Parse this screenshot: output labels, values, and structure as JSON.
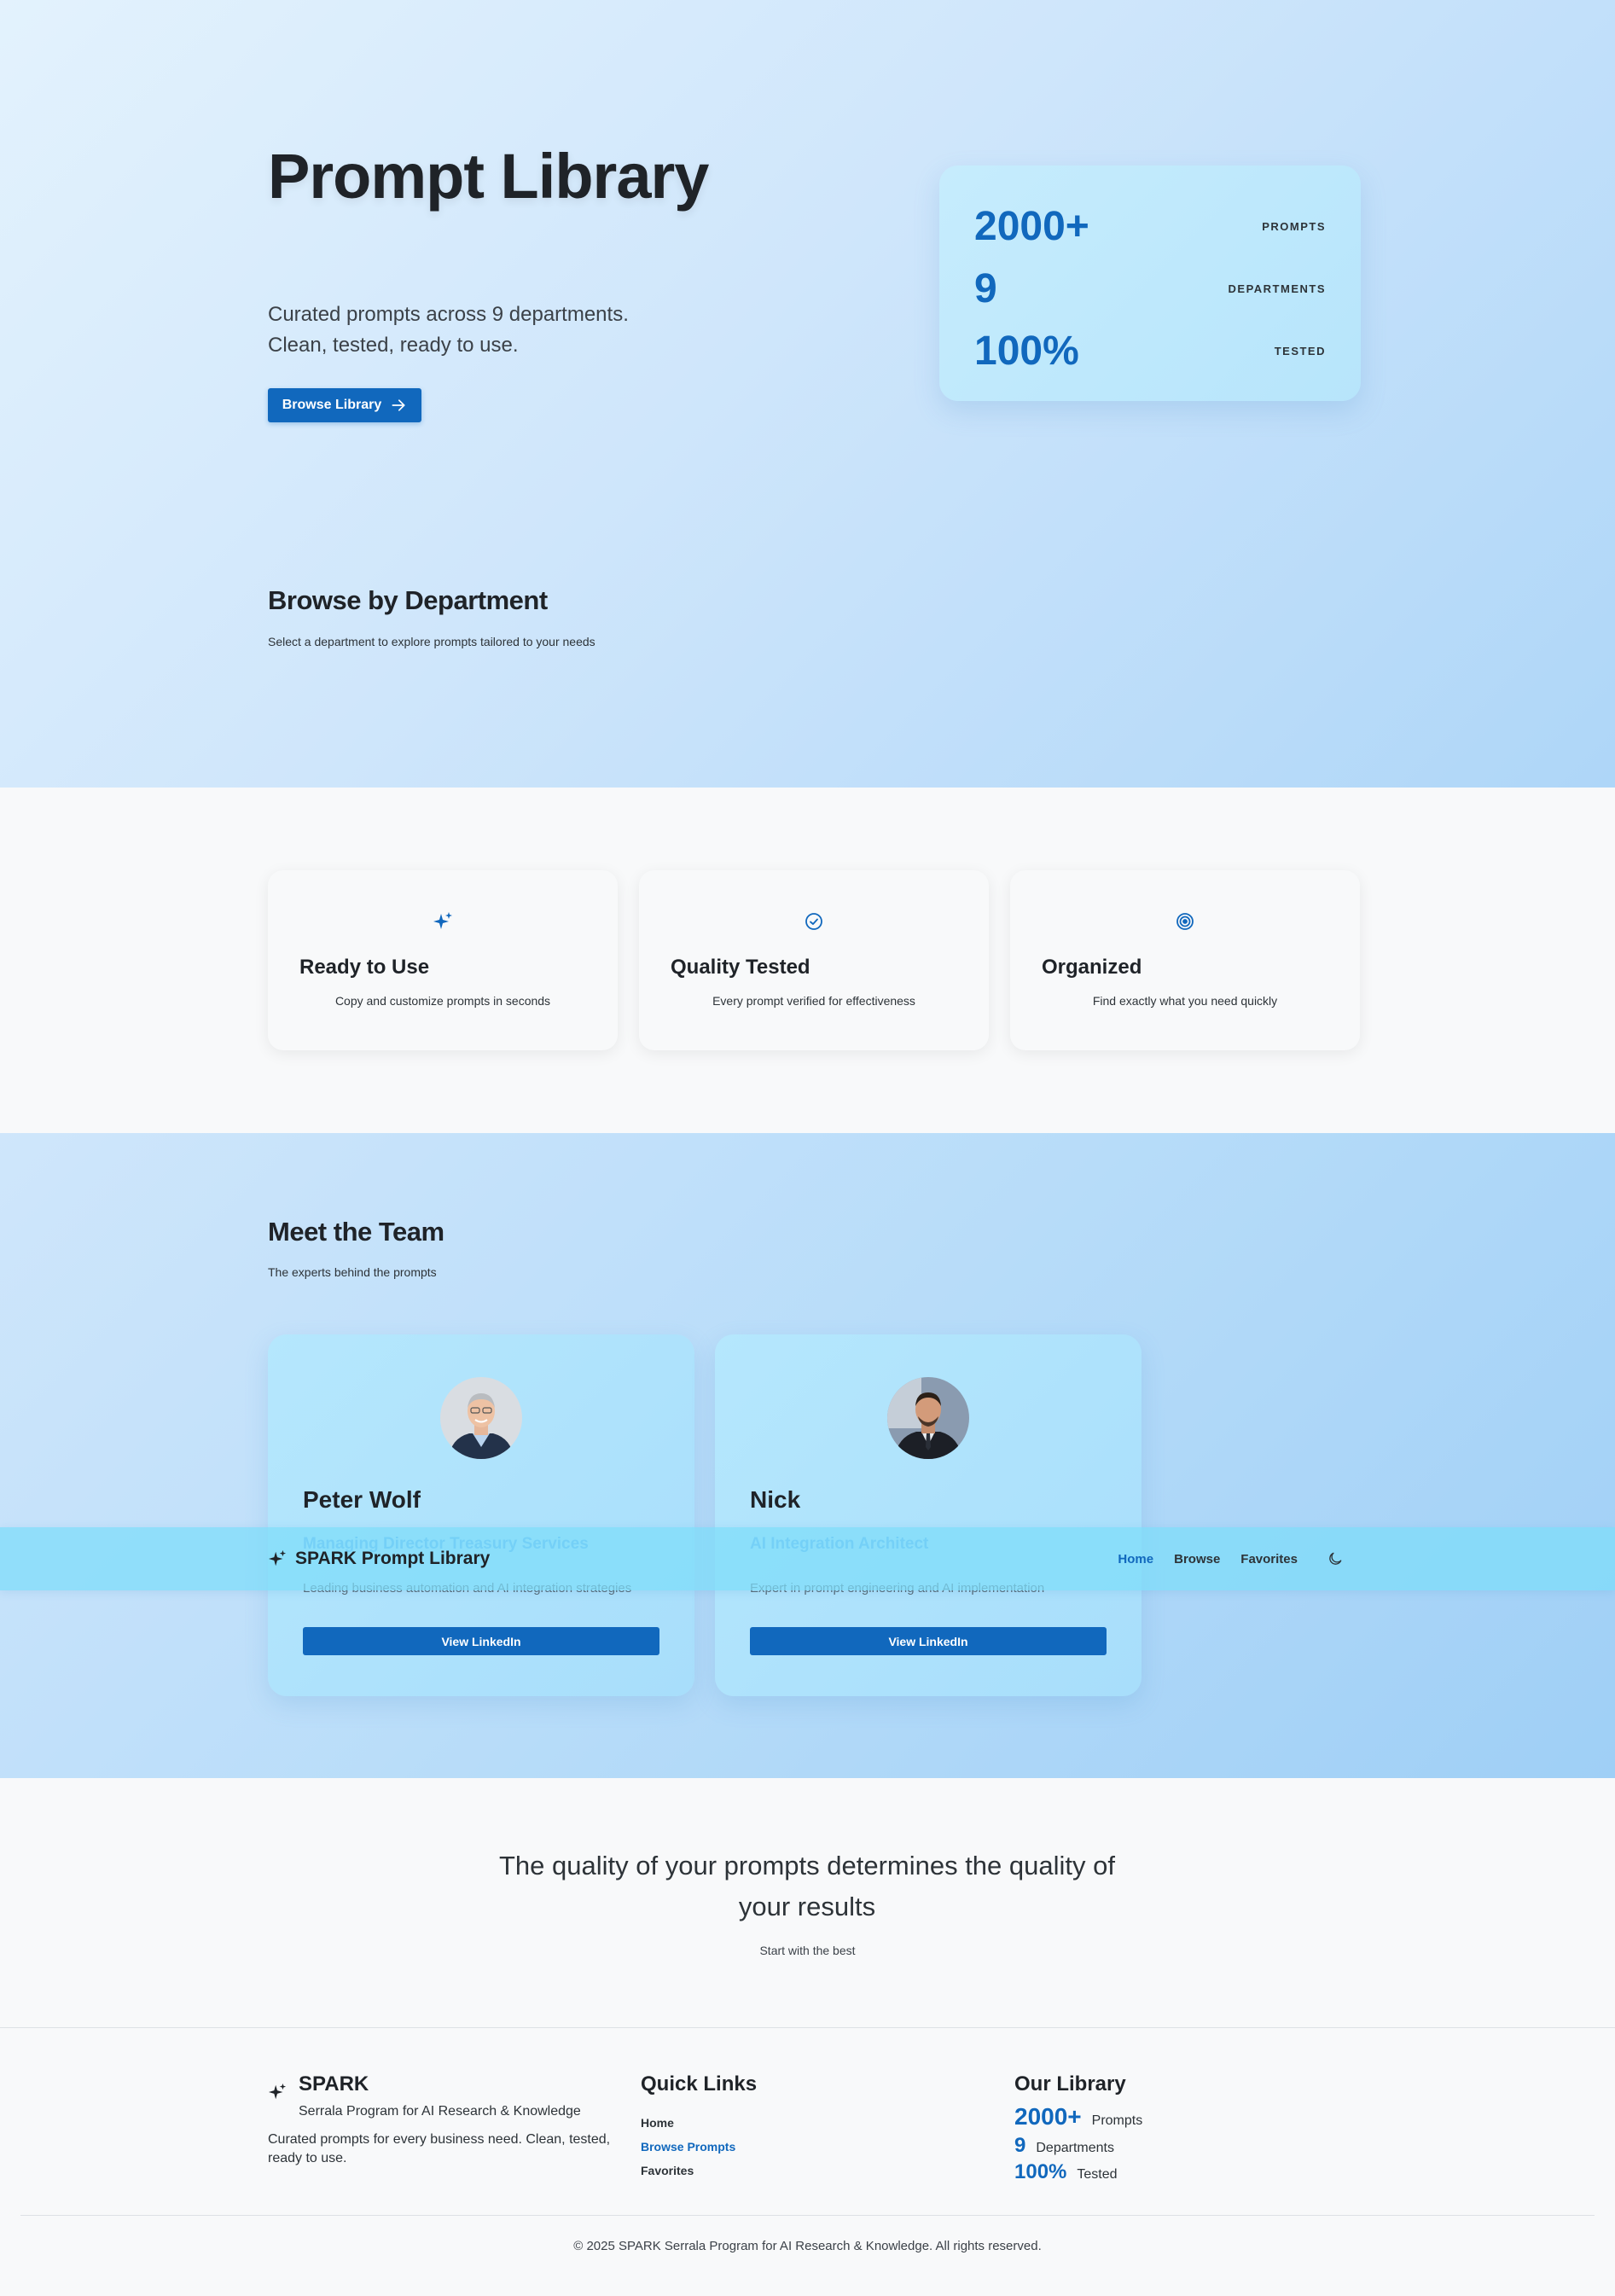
{
  "hero": {
    "title": "Prompt Library",
    "subtitle_line1": "Curated prompts across 9 departments.",
    "subtitle_line2": "Clean, tested, ready to use.",
    "browse_button": "Browse Library",
    "stats": [
      {
        "value": "2000+",
        "label": "PROMPTS"
      },
      {
        "value": "9",
        "label": "DEPARTMENTS"
      },
      {
        "value": "100%",
        "label": "TESTED"
      }
    ]
  },
  "departments": {
    "title": "Browse by Department",
    "subtitle": "Select a department to explore prompts tailored to your needs"
  },
  "features": [
    {
      "icon": "sparkles-icon",
      "title": "Ready to Use",
      "desc": "Copy and customize prompts in seconds"
    },
    {
      "icon": "check-circle-icon",
      "title": "Quality Tested",
      "desc": "Every prompt verified for effectiveness"
    },
    {
      "icon": "target-icon",
      "title": "Organized",
      "desc": "Find exactly what you need quickly"
    }
  ],
  "team": {
    "title": "Meet the Team",
    "subtitle": "The experts behind the prompts",
    "members": [
      {
        "name": "Peter Wolf",
        "role": "Managing Director Treasury Services",
        "desc": "Leading business automation and AI integration strategies",
        "button": "View LinkedIn"
      },
      {
        "name": "Nick",
        "role": "AI Integration Architect",
        "desc": "Expert in prompt engineering and AI implementation",
        "button": "View LinkedIn"
      }
    ]
  },
  "navbar": {
    "brand": "SPARK Prompt Library",
    "links": [
      "Home",
      "Browse",
      "Favorites"
    ],
    "active_link": "Home",
    "theme_toggle_icon": "moon-icon"
  },
  "quote": {
    "line1": "The quality of your prompts determines the quality of",
    "line2": "your results",
    "subtitle": "Start with the best"
  },
  "footer": {
    "brand_name": "SPARK",
    "brand_full": "Serrala Program for AI Research & Knowledge",
    "brand_desc": "Curated prompts for every business need. Clean, tested, ready to use.",
    "quick_links_title": "Quick Links",
    "quick_links": [
      "Home",
      "Browse Prompts",
      "Favorites"
    ],
    "library_title": "Our Library",
    "library_stats": [
      {
        "value": "2000+",
        "label": "Prompts"
      },
      {
        "value": "9",
        "label": "Departments"
      },
      {
        "value": "100%",
        "label": "Tested"
      }
    ],
    "copyright": "© 2025 SPARK Serrala Program for AI Research & Knowledge. All rights reserved."
  },
  "colors": {
    "accent": "#1168bd",
    "text": "#1f2328",
    "hero_bg_start": "#e3f2fd",
    "hero_bg_end": "#aed6f8"
  }
}
